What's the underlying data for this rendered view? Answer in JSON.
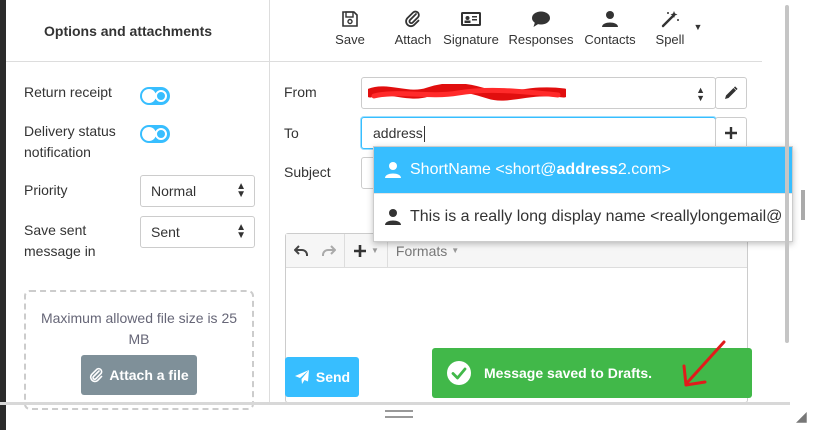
{
  "sidebar": {
    "title": "Options and attachments",
    "return_receipt_label": "Return receipt",
    "delivery_status_label": "Delivery status notification",
    "priority_label": "Priority",
    "priority_value": "Normal",
    "save_sent_label": "Save sent message in",
    "save_sent_value": "Sent",
    "max_size_text": "Maximum allowed file size is 25 MB",
    "attach_file_label": "Attach a file"
  },
  "toolbar": {
    "save": "Save",
    "attach": "Attach",
    "signature": "Signature",
    "responses": "Responses",
    "contacts": "Contacts",
    "spell": "Spell"
  },
  "compose": {
    "from_label": "From",
    "to_label": "To",
    "subject_label": "Subject",
    "to_value": "address"
  },
  "suggestions": [
    {
      "prefix": "ShortName <short@",
      "bold": "address",
      "suffix": "2.com>"
    },
    {
      "text": "This is a really long display name <reallylongemail@"
    }
  ],
  "editor": {
    "formats_label": "Formats"
  },
  "send_label": "Send",
  "toast": {
    "message": "Message saved to Drafts."
  },
  "colors": {
    "accent": "#37beff",
    "success": "#41b849",
    "attach_button": "#7f9099"
  }
}
